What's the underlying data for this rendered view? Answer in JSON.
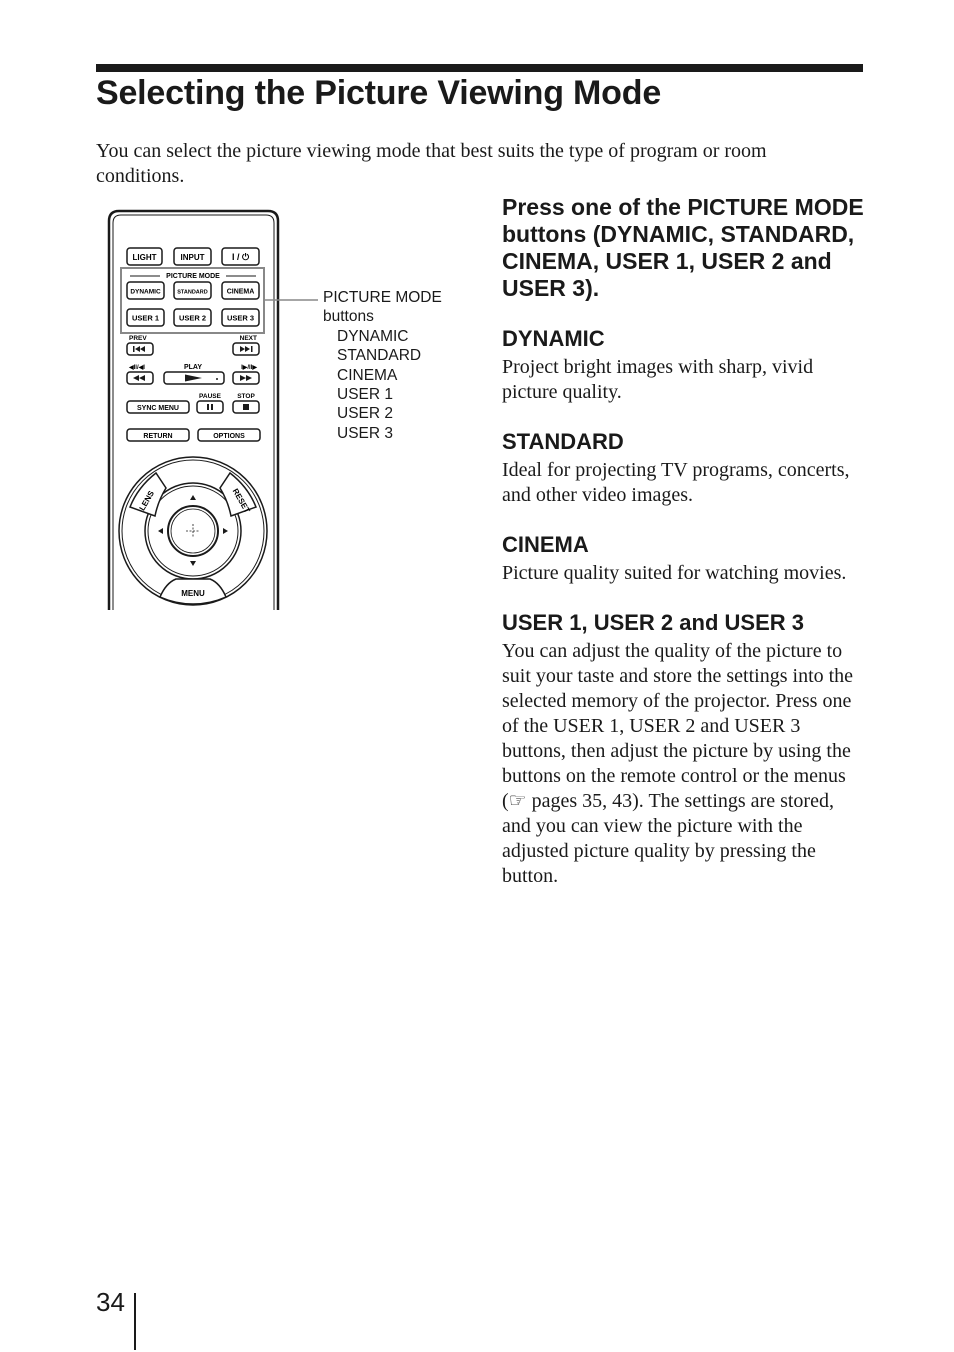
{
  "page": {
    "title": "Selecting the Picture Viewing Mode",
    "intro": "You can select the picture viewing mode that best suits the type of program or room conditions.",
    "page_number": "34"
  },
  "remote": {
    "buttons": {
      "light": "LIGHT",
      "input": "INPUT",
      "power": "I / ⏻",
      "dynamic": "DYNAMIC",
      "standard": "STANDARD",
      "cinema": "CINEMA",
      "user1": "USER 1",
      "user2": "USER 2",
      "user3": "USER 3",
      "sync_menu": "SYNC MENU",
      "return": "RETURN",
      "options": "OPTIONS",
      "lens": "LENS",
      "reset": "RESET",
      "menu": "MENU"
    },
    "labels": {
      "picture_mode": "PICTURE MODE",
      "prev": "PREV",
      "next": "NEXT",
      "rewind": "◀II/◀I",
      "play": "PLAY",
      "forward": "I▶/II▶",
      "pause": "PAUSE",
      "stop": "STOP"
    }
  },
  "callout": {
    "line1": "PICTURE MODE",
    "line2": "buttons",
    "items": [
      "DYNAMIC",
      "STANDARD",
      "CINEMA",
      "USER 1",
      "USER 2",
      "USER 3"
    ]
  },
  "instruction": "Press one of the PICTURE MODE buttons (DYNAMIC, STANDARD, CINEMA, USER 1, USER 2 and USER 3).",
  "sections": [
    {
      "heading": "DYNAMIC",
      "body": "Project bright images with sharp, vivid picture quality."
    },
    {
      "heading": "STANDARD",
      "body": "Ideal for projecting TV programs, concerts, and other video images."
    },
    {
      "heading": "CINEMA",
      "body": "Picture quality suited for watching movies."
    },
    {
      "heading": "USER 1, USER 2 and USER 3",
      "body_before_ref": "You can adjust the quality of the picture to suit your taste and store the settings into the selected memory of the projector. Press one of the USER 1, USER 2 and USER 3 buttons, then adjust the picture by using the buttons on the remote control or the menus (",
      "ref_icon": "☞",
      "body_after_ref": " pages 35, 43). The settings are stored, and you can view the picture with the adjusted picture quality by pressing the button."
    }
  ]
}
